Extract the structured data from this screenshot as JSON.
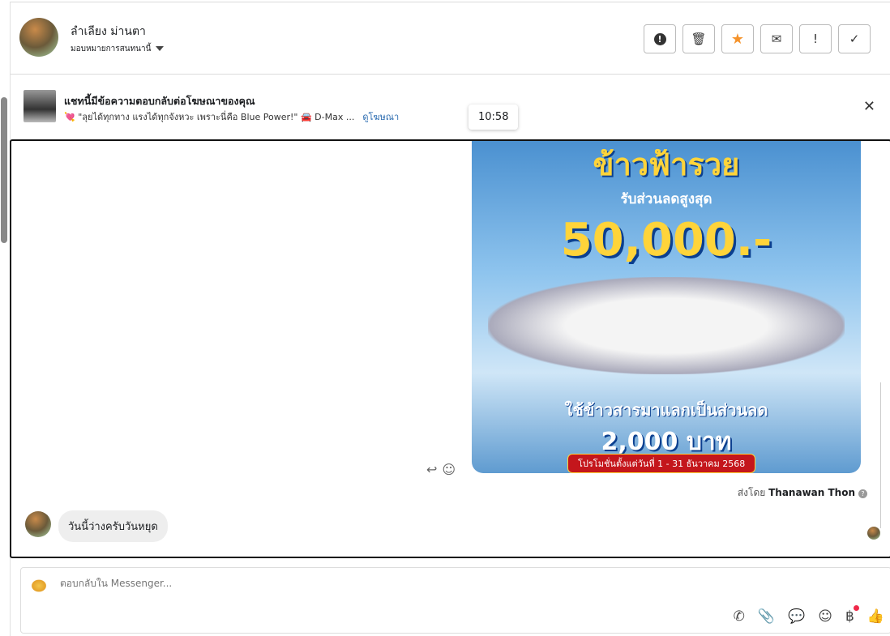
{
  "header": {
    "name": "ลำเลียง ม่านตา",
    "assign_label": "มอบหมายการสนทนานี้"
  },
  "actions": [
    {
      "name": "spam",
      "glyph": "❗"
    },
    {
      "name": "delete",
      "glyph": "🗑"
    },
    {
      "name": "star",
      "glyph": "★"
    },
    {
      "name": "mark-unread",
      "glyph": "✉"
    },
    {
      "name": "follow-up",
      "glyph": "!"
    },
    {
      "name": "done",
      "glyph": "✓"
    }
  ],
  "accent": {
    "star": "#f5932b",
    "link": "#2a6bb0"
  },
  "ad_bar": {
    "title": "แชทนี้มีข้อความตอบกลับต่อโฆษณาของคุณ",
    "snippet": "💘 \"ลุยได้ทุกทาง แรงได้ทุกจังหวะ เพราะนี่คือ Blue Power!\" 🚘 D-Max ...",
    "view_ad": "ดูโฆษณา"
  },
  "tooltip": "10:58",
  "ad_image": {
    "headline": "ข้าวฟ้ารวย",
    "discount_label": "รับส่วนลดสูงสุด",
    "discount": "50,000.-",
    "sub": "ใช้ข้าวสารมาแลกเป็นส่วนลด",
    "per_kg": "2,000 บาท",
    "promo": "โปรโมชั่นตั้งแต่วันที่ 1 - 31 ธันวาคม 2568"
  },
  "sent_by": {
    "prefix": "ส่งโดย",
    "name": "Thanawan Thon"
  },
  "message": "วันนี้ว่างครับวันหยุด",
  "composer": {
    "placeholder": "ตอบกลับใน Messenger..."
  }
}
